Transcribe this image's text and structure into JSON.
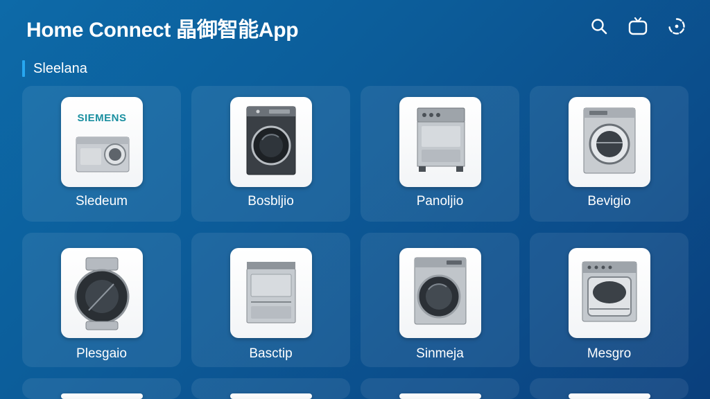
{
  "header": {
    "title": "Home Connect 晶御智能App",
    "icons": [
      "search-icon",
      "tv-icon",
      "settings-icon"
    ]
  },
  "section": {
    "title": "Sleelana"
  },
  "appliances": [
    {
      "label": "Sledeum",
      "brand": "SIEMENS",
      "icon": "siemens-appliance-image"
    },
    {
      "label": "Bosbljio",
      "icon": "front-load-washer-image"
    },
    {
      "label": "Panoljio",
      "icon": "range-oven-image"
    },
    {
      "label": "Bevigio",
      "icon": "washing-machine-image"
    },
    {
      "label": "Plesgaio",
      "icon": "drum-appliance-image"
    },
    {
      "label": "Basctip",
      "icon": "dishwasher-image"
    },
    {
      "label": "Sinmeja",
      "icon": "washer-dryer-image"
    },
    {
      "label": "Mesgro",
      "icon": "oven-image"
    }
  ],
  "colors": {
    "accent": "#27a7f0",
    "background_top": "#0d6aa8",
    "background_bottom": "#0a3f7c",
    "brand": "#1a8fa0"
  }
}
